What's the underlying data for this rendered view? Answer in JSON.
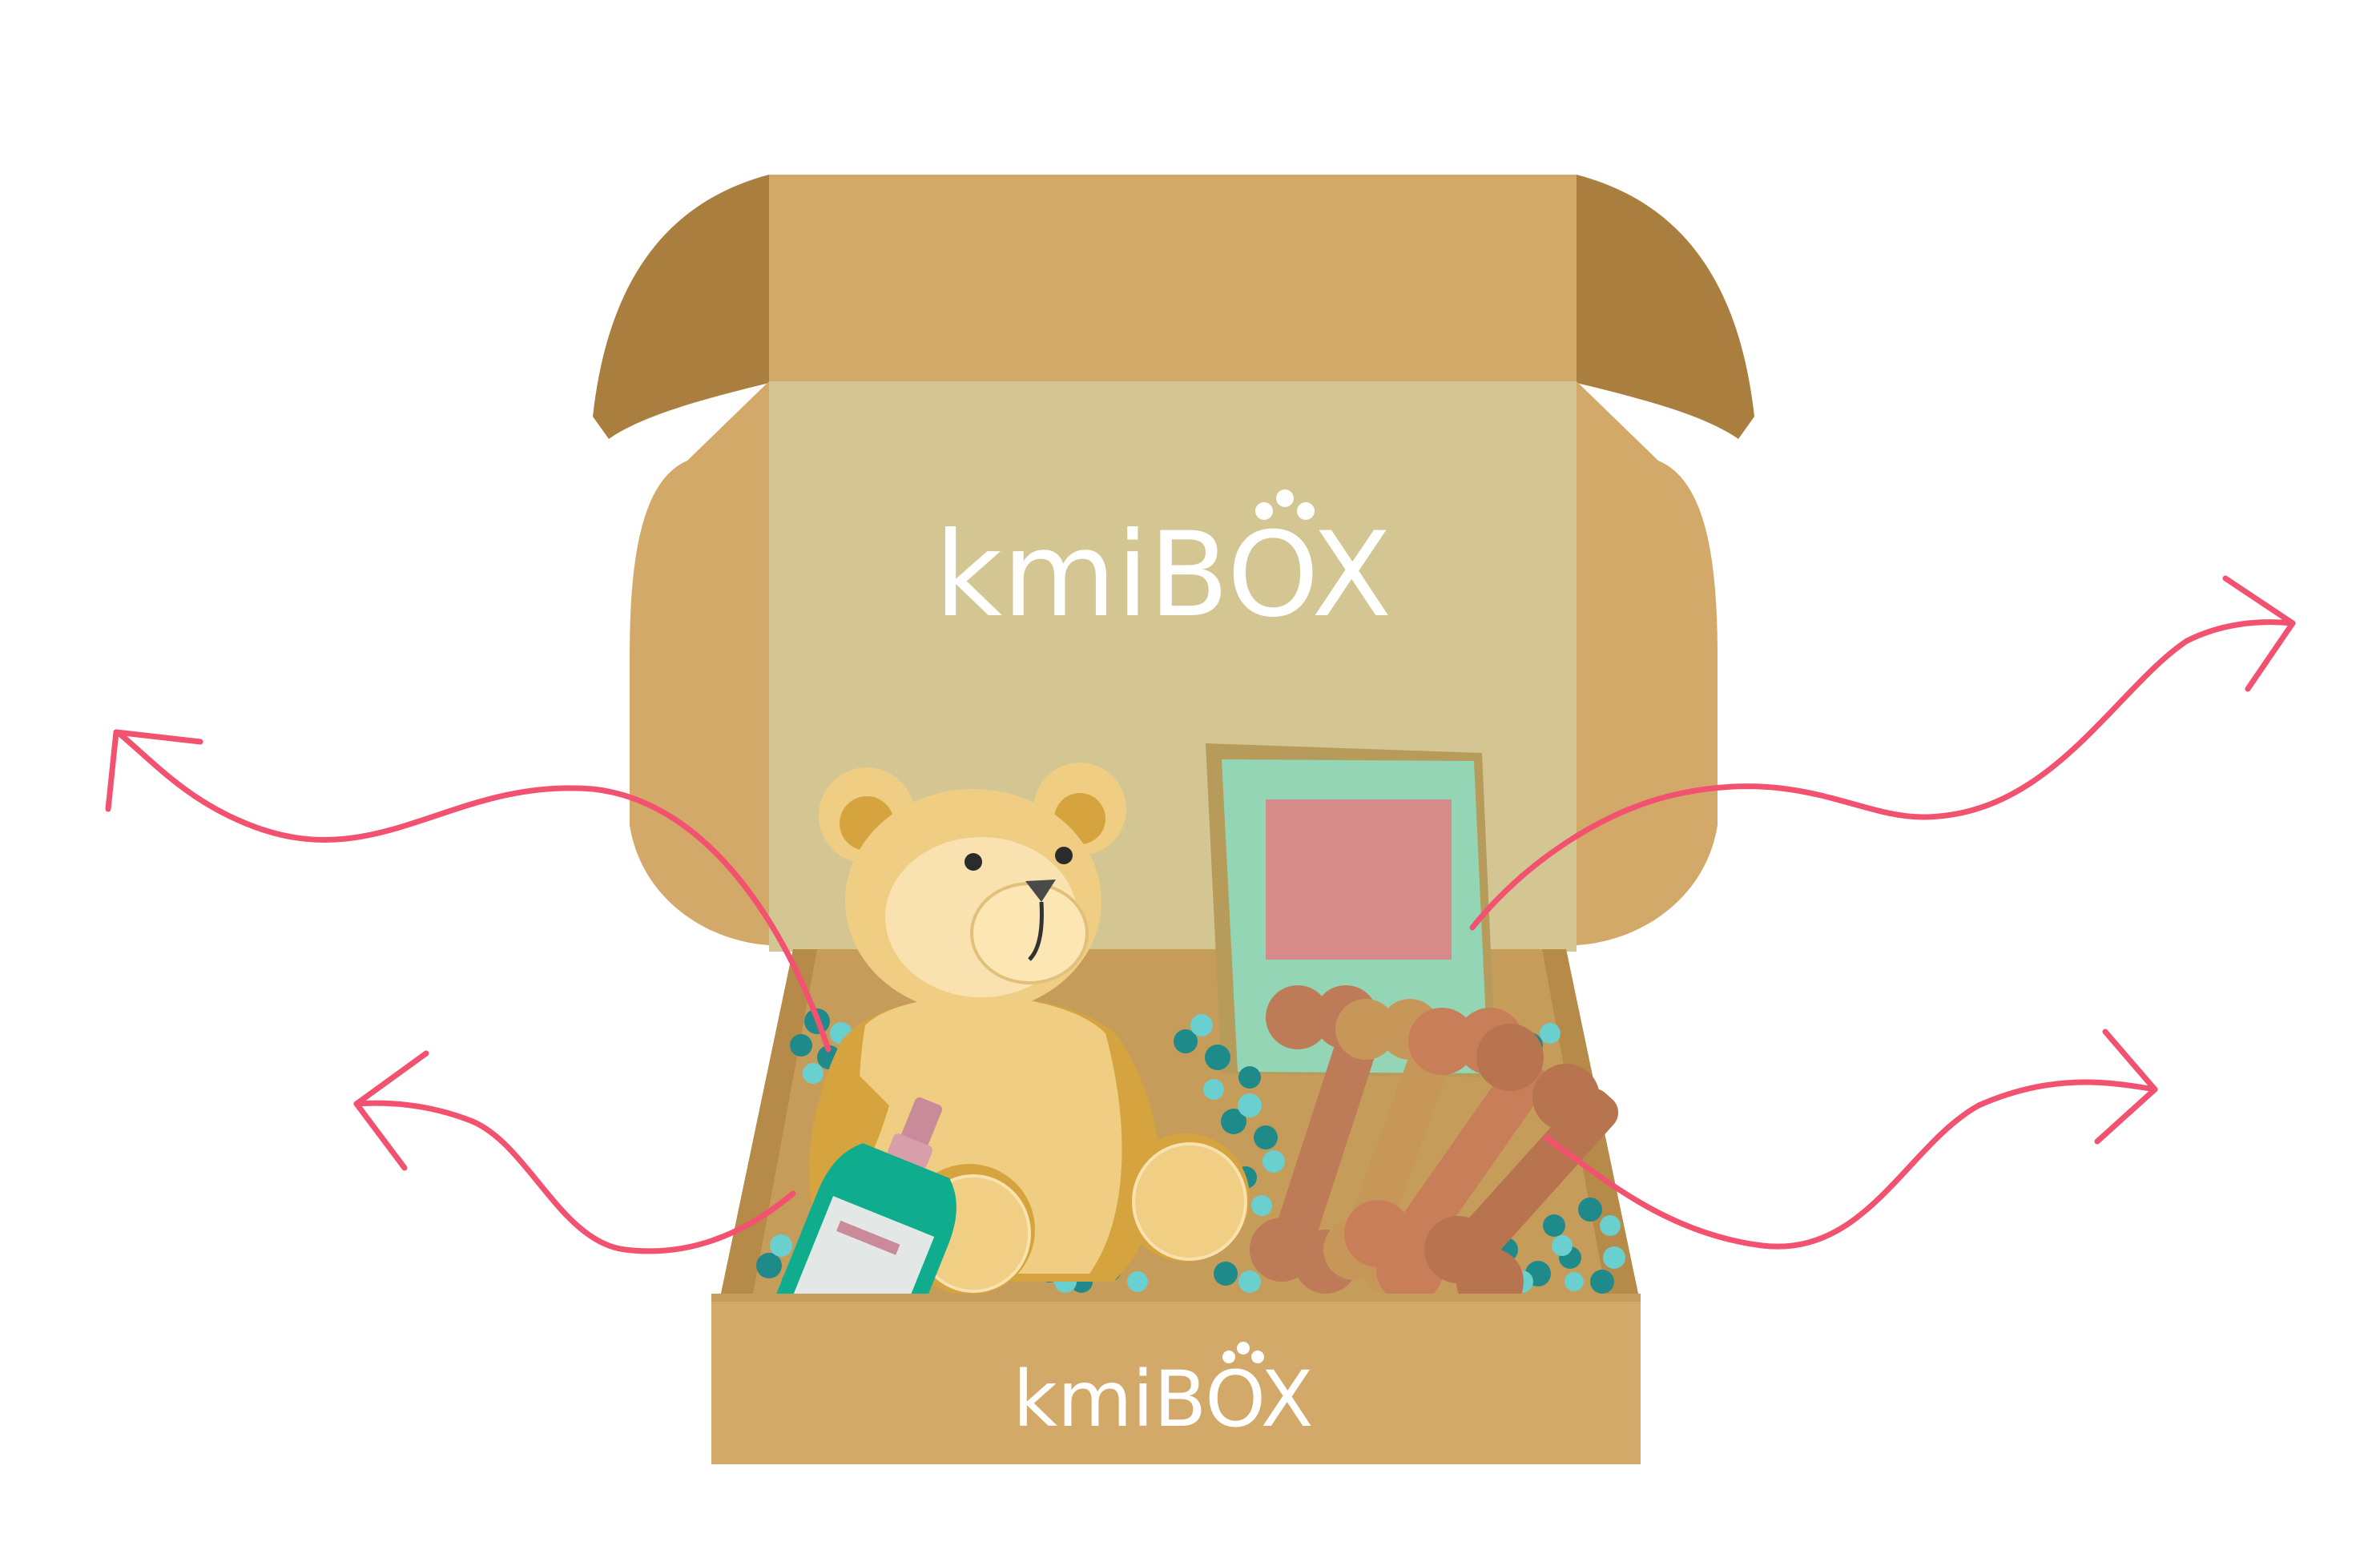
{
  "box": {
    "inner_logo": {
      "word": "kmi",
      "box_letters": "BOX"
    },
    "front_logo": {
      "word": "kmi",
      "box_letters": "BOX"
    }
  },
  "items": [
    "teddy-bear",
    "treat-bag",
    "dog-bones",
    "shampoo-bottle",
    "packing-filler"
  ],
  "colors": {
    "cardboard": "#D2A969",
    "cardboard_dark": "#A97E3E",
    "inner_panel": "#D3C693",
    "arrow": "#F2516F",
    "teal": "#1E8A89",
    "teal_light": "#6ACFCF",
    "bear": "#EFCD82",
    "bear_dark": "#D5A43F",
    "bag": "#93D5B5",
    "bag_label": "#D68A89",
    "bone": "#C87E59",
    "bottle": "#0FAD8E"
  }
}
